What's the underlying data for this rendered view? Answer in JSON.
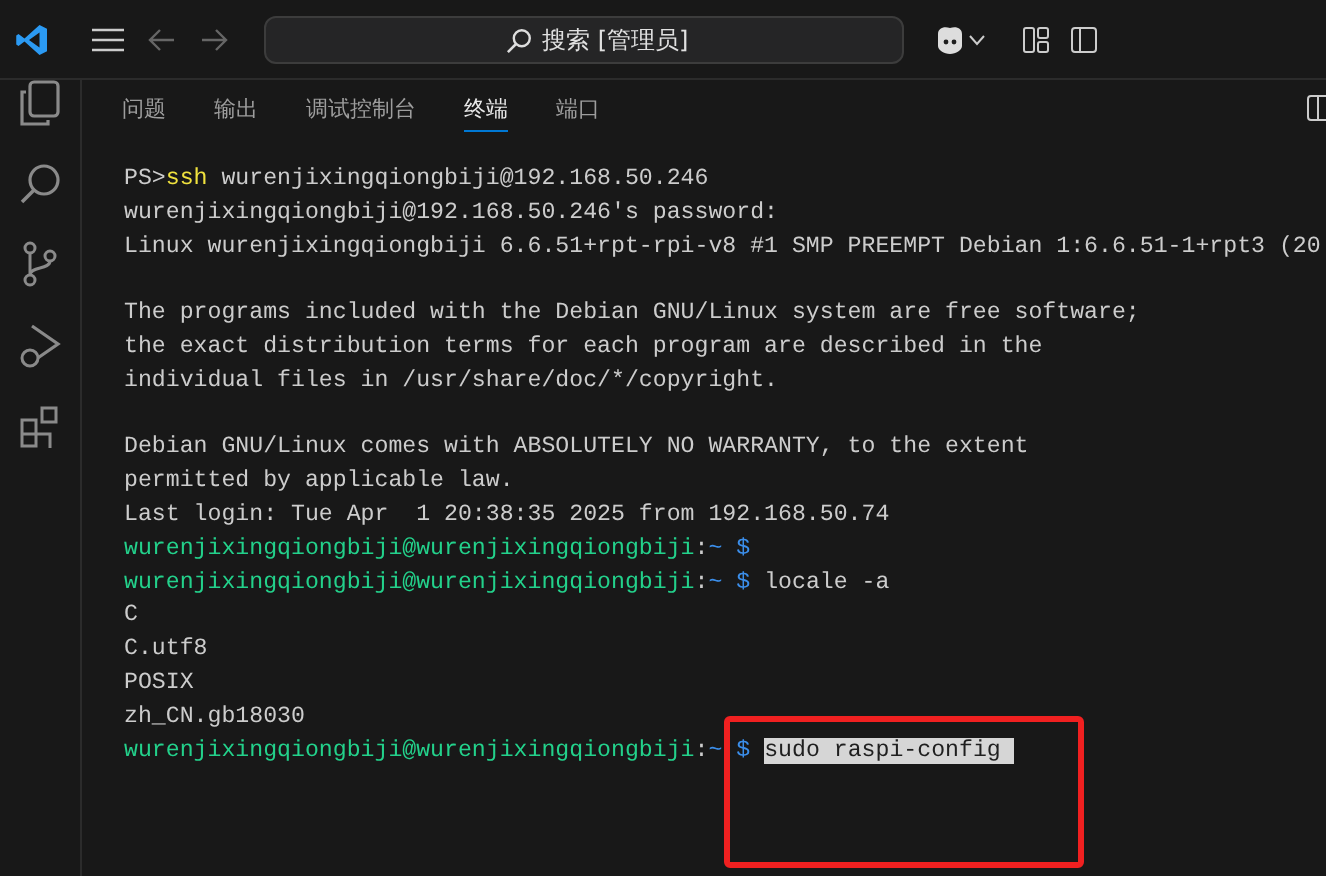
{
  "titlebar": {
    "search": {
      "placeholder": "搜索 [管理员]"
    }
  },
  "panel": {
    "tabs": [
      {
        "label": "问题",
        "selected": false
      },
      {
        "label": "输出",
        "selected": false
      },
      {
        "label": "调试控制台",
        "selected": false
      },
      {
        "label": "终端",
        "selected": true
      },
      {
        "label": "端口",
        "selected": false
      }
    ]
  },
  "terminal": {
    "lines": [
      {
        "gap_before": false,
        "segments": [
          {
            "kind": "plain",
            "text": "PS>"
          },
          {
            "kind": "command",
            "text": "ssh"
          },
          {
            "kind": "plain",
            "text": " wurenjixingqiongbiji@192.168.50.246"
          }
        ]
      },
      {
        "gap_before": false,
        "segments": [
          {
            "kind": "plain",
            "text": "wurenjixingqiongbiji@192.168.50.246's password:"
          }
        ]
      },
      {
        "gap_before": false,
        "segments": [
          {
            "kind": "plain",
            "text": "Linux wurenjixingqiongbiji 6.6.51+rpt-rpi-v8 #1 SMP PREEMPT Debian 1:6.6.51-1+rpt3 (20"
          }
        ]
      },
      {
        "gap_before": true,
        "segments": [
          {
            "kind": "plain",
            "text": "The programs included with the Debian GNU/Linux system are free software;"
          }
        ]
      },
      {
        "gap_before": false,
        "segments": [
          {
            "kind": "plain",
            "text": "the exact distribution terms for each program are described in the"
          }
        ]
      },
      {
        "gap_before": false,
        "segments": [
          {
            "kind": "plain",
            "text": "individual files in /usr/share/doc/*/copyright."
          }
        ]
      },
      {
        "gap_before": true,
        "segments": [
          {
            "kind": "plain",
            "text": "Debian GNU/Linux comes with ABSOLUTELY NO WARRANTY, to the extent"
          }
        ]
      },
      {
        "gap_before": false,
        "segments": [
          {
            "kind": "plain",
            "text": "permitted by applicable law."
          }
        ]
      },
      {
        "gap_before": false,
        "segments": [
          {
            "kind": "plain",
            "text": "Last login: Tue Apr  1 20:38:35 2025 from 192.168.50.74"
          }
        ]
      },
      {
        "gap_before": false,
        "segments": [
          {
            "kind": "user",
            "text": "wurenjixingqiongbiji@wurenjixingqiongbiji"
          },
          {
            "kind": "plain",
            "text": ":"
          },
          {
            "kind": "path",
            "text": "~ $"
          }
        ]
      },
      {
        "gap_before": false,
        "segments": [
          {
            "kind": "user",
            "text": "wurenjixingqiongbiji@wurenjixingqiongbiji"
          },
          {
            "kind": "plain",
            "text": ":"
          },
          {
            "kind": "path",
            "text": "~ $"
          },
          {
            "kind": "plain",
            "text": " locale -a"
          }
        ]
      },
      {
        "gap_before": false,
        "segments": [
          {
            "kind": "plain",
            "text": "C"
          }
        ]
      },
      {
        "gap_before": false,
        "segments": [
          {
            "kind": "plain",
            "text": "C.utf8"
          }
        ]
      },
      {
        "gap_before": false,
        "segments": [
          {
            "kind": "plain",
            "text": "POSIX"
          }
        ]
      },
      {
        "gap_before": false,
        "segments": [
          {
            "kind": "plain",
            "text": "zh_CN.gb18030"
          }
        ]
      },
      {
        "gap_before": false,
        "segments": [
          {
            "kind": "user",
            "text": "wurenjixingqiongbiji@wurenjixingqiongbiji"
          },
          {
            "kind": "plain",
            "text": ":"
          },
          {
            "kind": "path",
            "text": "~ $ "
          },
          {
            "kind": "selection",
            "text": "sudo raspi-config "
          }
        ]
      }
    ]
  }
}
